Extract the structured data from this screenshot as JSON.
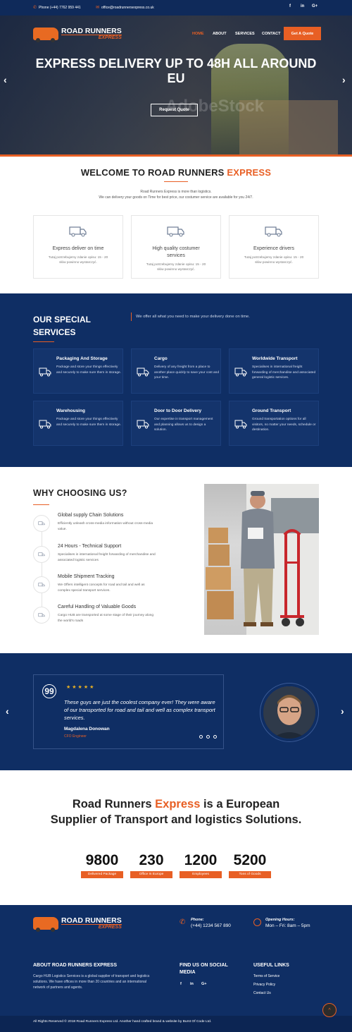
{
  "topbar": {
    "phone": "Phone (+44) 7762 959 441",
    "email": "office@roadrunnersexpress.co.uk",
    "social": [
      "f",
      "in",
      "G+"
    ]
  },
  "brand": {
    "name": "ROAD RUNNERS",
    "tagline": "EXPRESS"
  },
  "nav": {
    "items": [
      "HOME",
      "ABOUT",
      "SERVICES",
      "CONTACT"
    ],
    "cta": "Get A Quote"
  },
  "hero": {
    "title": "EXPRESS DELIVERY UP TO 48H ALL AROUND EU",
    "button": "Request Quote",
    "watermark": "AdobeStock",
    "prev": "‹",
    "next": "›"
  },
  "welcome": {
    "title_main": "WELCOME TO ROAD RUNNERS ",
    "title_accent": "EXPRESS",
    "desc_line1": "Road Runners Express is more than logistics.",
    "desc_line2": "We can delivery your goods on Time for best price, our costumer service are available for you 24/7.",
    "cards": [
      {
        "title": "Express deliver on time",
        "desc": "Tutaj potrzebujemy zdanie opisu: 15 - 20 słów powinno wystarczyć."
      },
      {
        "title": "High quality costumer services",
        "desc": "Tutaj potrzebujemy zdanie opisu: 15 - 20 słów powinno wystarczyć."
      },
      {
        "title": "Experience drivers",
        "desc": "Tutaj potrzebujemy zdanie opisu: 15 - 20 słów powinno wystarczyć."
      }
    ]
  },
  "services": {
    "title_line1": "OUR SPECIAL",
    "title_line2": "SERVICES",
    "intro": "We offer all what you need to make your delivery done on time.",
    "items": [
      {
        "title": "Packaging And Storage",
        "desc": "Package and store your things effectively and securely to make sure them in storage."
      },
      {
        "title": "Cargo",
        "desc": "Delivery of any freight from a place to another place quickly to save your cost and your time."
      },
      {
        "title": "Worldwide Transport",
        "desc": "Specialises in international freight forwarding of merchandise and associated general logistic services."
      },
      {
        "title": "Warehousing",
        "desc": "Package and store your things effectively and securely to make sure them in storage."
      },
      {
        "title": "Door to Door Delivery",
        "desc": "Our expertise in transport management and planning allows us to design a solution."
      },
      {
        "title": "Ground Transport",
        "desc": "Ground transportation options for all visitors, no matter your needs, schedule or destination."
      }
    ]
  },
  "why": {
    "title": "WHY CHOOSING US?",
    "items": [
      {
        "title": "Global supply Chain Solutions",
        "desc": "Efficiently unleash cross-media information without cross-media value."
      },
      {
        "title": "24 Hours - Technical Support",
        "desc": "Specialises in international freight forwarding of merchandise and associated logistic services"
      },
      {
        "title": "Mobile Shipment Tracking",
        "desc": "We Offers intelligent concepts for road and tail and well as complex special transport services."
      },
      {
        "title": "Careful Handling of Valuable Goods",
        "desc": "Cargo HUB are transported at some stage of their journey along the world's roads"
      }
    ]
  },
  "testimonial": {
    "quote_mark": "99",
    "stars": "★★★★★",
    "quote": "These guys are just the coolest company ever! They were aware of our transported for road and tail and well as complex transport services.",
    "name": "Magdalena Donowan",
    "role": "CFO Engineer",
    "prev": "‹",
    "next": "›"
  },
  "stats": {
    "title_part1": "Road Runners ",
    "title_accent": "Express",
    "title_part2": " is a European Supplier of Transport and logistics Solutions.",
    "items": [
      {
        "number": "9800",
        "label": "Delivered Package"
      },
      {
        "number": "230",
        "label": "Office In Europe"
      },
      {
        "number": "1200",
        "label": "Employees"
      },
      {
        "number": "5200",
        "label": "Tons of Goods"
      }
    ]
  },
  "footer": {
    "phone_label": "Phone:",
    "phone": "(+44) 1234 567 890",
    "hours_label": "Opening Hours:",
    "hours": "Mon – Fri: 8am – 5pm",
    "about_title": "ABOUT ROAD RUNNERS EXPRESS",
    "about_text": "Cargo HUB Logistics Services is a global supplier of transport and logistics solutions. We have offices in more than 20 countries and an international network of partners and agents.",
    "social_title": "FIND US ON SOCIAL MEDIA",
    "social": [
      "f",
      "in",
      "G+"
    ],
    "links_title": "USEFUL LINKS",
    "links": [
      "Terms of Service",
      "Privacy Policy",
      "Contact Us"
    ],
    "copyright": "All Rights Reserved © 2018 Road Runners Express Ltd. Another hand crafted brand & website by Burst Of Code Ltd.",
    "to_top": "^"
  },
  "colors": {
    "accent": "#e85f24",
    "navy": "#0f2e64",
    "dark_navy": "#0c2553"
  }
}
